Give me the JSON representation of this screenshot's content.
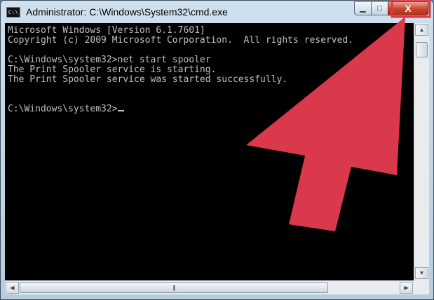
{
  "window": {
    "title": "Administrator: C:\\Windows\\System32\\cmd.exe",
    "icon": "cmd-icon",
    "icon_text": "C:\\"
  },
  "controls": {
    "minimize_glyph": "▁",
    "maximize_glyph": "□",
    "close_glyph": "X"
  },
  "console": {
    "lines": [
      "Microsoft Windows [Version 6.1.7601]",
      "Copyright (c) 2009 Microsoft Corporation.  All rights reserved.",
      "",
      "C:\\Windows\\system32>net start spooler",
      "The Print Spooler service is starting.",
      "The Print Spooler service was started successfully.",
      "",
      "",
      "C:\\Windows\\system32>"
    ]
  },
  "scrollbars": {
    "up_glyph": "▲",
    "down_glyph": "▼",
    "left_glyph": "◀",
    "right_glyph": "▶",
    "grip_glyph": "|||"
  },
  "annotation": {
    "arrow_color": "#d9394a",
    "highlight_color": "#d9394a"
  }
}
